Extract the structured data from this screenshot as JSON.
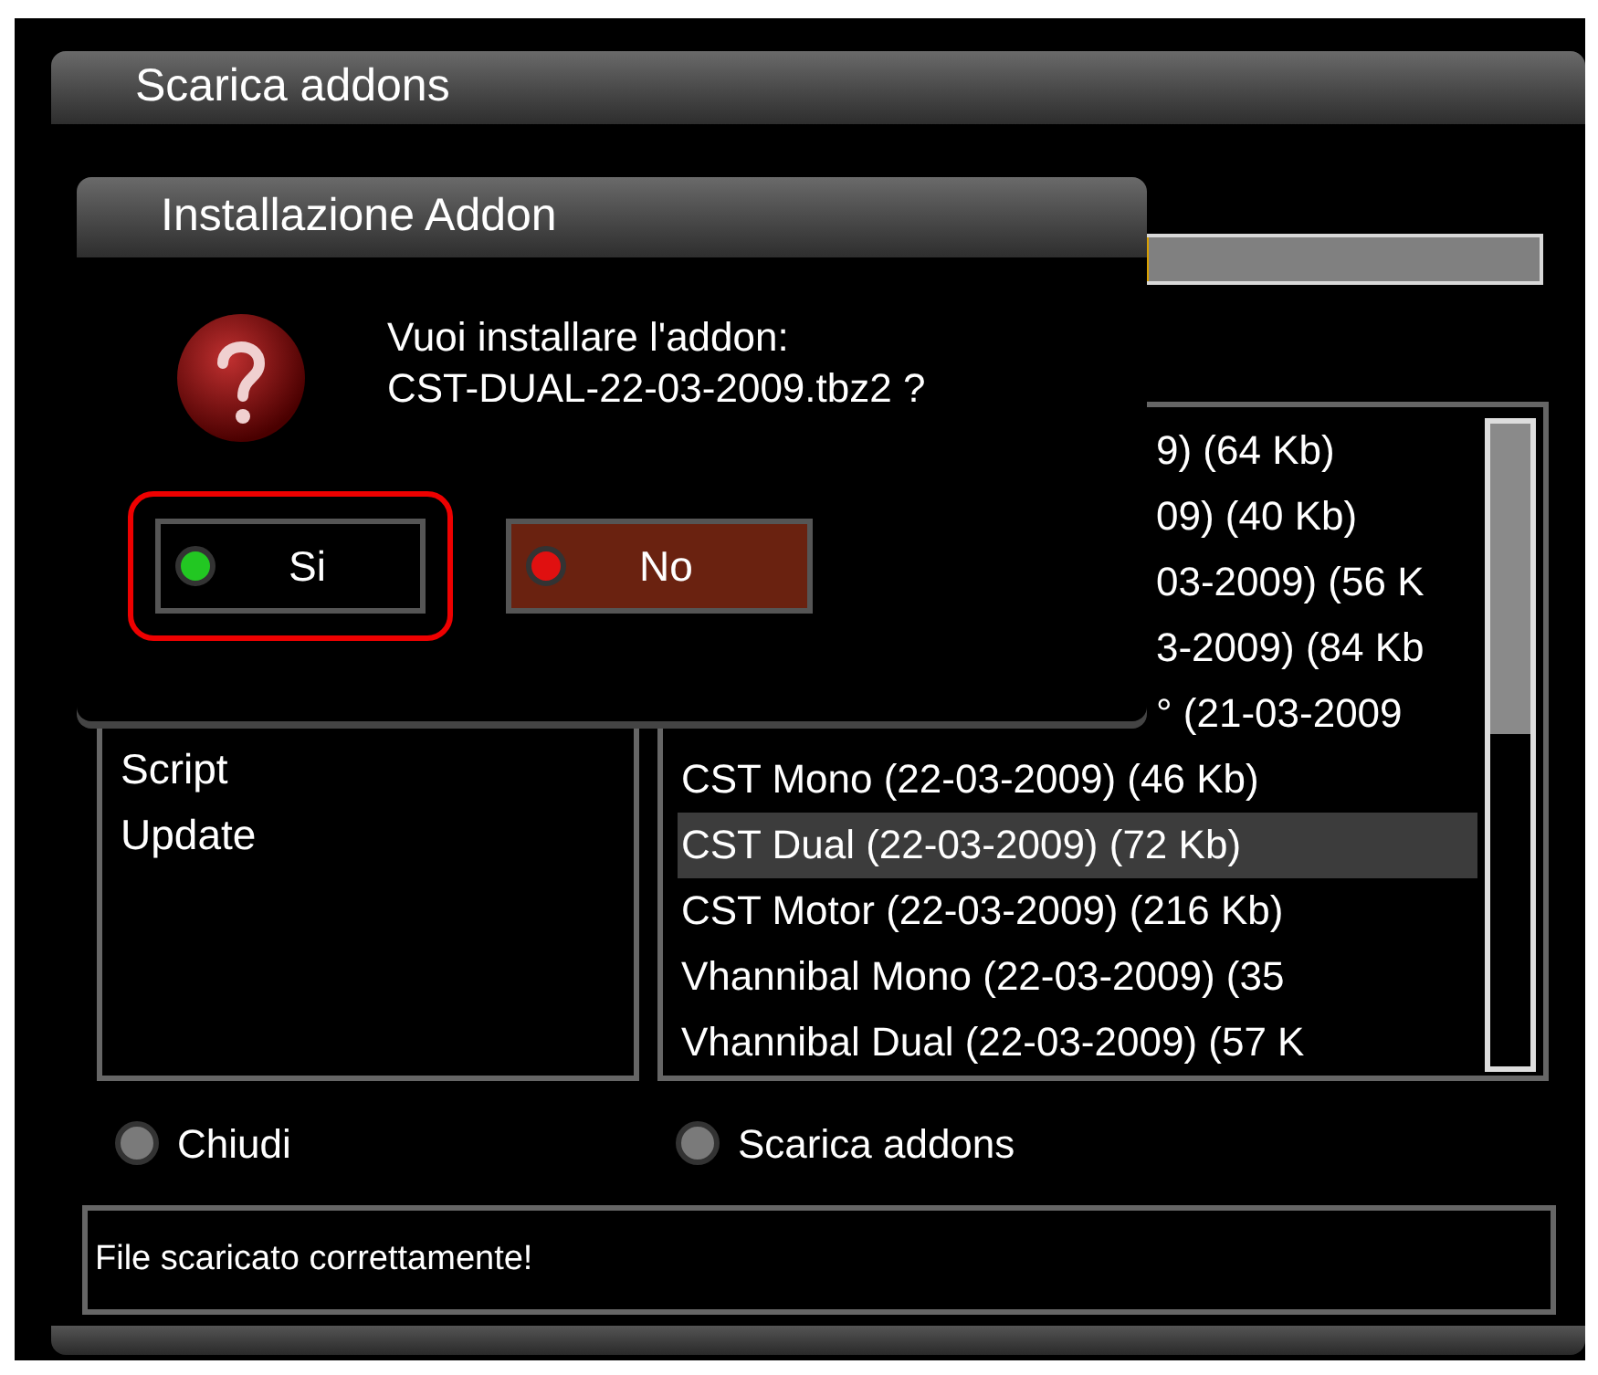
{
  "window": {
    "title": "Scarica addons"
  },
  "progress": {
    "level": 0.73
  },
  "categories": [
    {
      "label": "Script",
      "selected": false
    },
    {
      "label": "Update",
      "selected": false
    }
  ],
  "addons": [
    {
      "label": "9) (64 Kb)",
      "selected": false,
      "covered": true
    },
    {
      "label": "09) (40 Kb)",
      "selected": false,
      "covered": true
    },
    {
      "label": "03-2009) (56 K",
      "selected": false,
      "covered": true
    },
    {
      "label": "3-2009) (84 Kb",
      "selected": false,
      "covered": true
    },
    {
      "label": "° (21-03-2009",
      "selected": false,
      "covered": true
    },
    {
      "label": "CST Mono (22-03-2009) (46 Kb)",
      "selected": false,
      "covered": false
    },
    {
      "label": "CST Dual (22-03-2009) (72 Kb)",
      "selected": true,
      "covered": false
    },
    {
      "label": "CST Motor (22-03-2009) (216 Kb)",
      "selected": false,
      "covered": false
    },
    {
      "label": "Vhannibal Mono (22-03-2009) (35",
      "selected": false,
      "covered": false
    },
    {
      "label": "Vhannibal Dual (22-03-2009) (57 K",
      "selected": false,
      "covered": false
    }
  ],
  "keys": [
    {
      "label": "Chiudi",
      "color": "#7a7a7a"
    },
    {
      "label": "Scarica addons",
      "color": "#7a7a7a"
    }
  ],
  "status": "File scaricato correttamente!",
  "dialog": {
    "title": "Installazione Addon",
    "message": [
      "Vuoi installare l'addon:",
      "CST-DUAL-22-03-2009.tbz2 ?"
    ],
    "buttons": [
      {
        "label": "Si",
        "color": "#22c722",
        "focused": true,
        "kind": "plain"
      },
      {
        "label": "No",
        "color": "#e01010",
        "focused": false,
        "kind": "brown"
      }
    ]
  }
}
